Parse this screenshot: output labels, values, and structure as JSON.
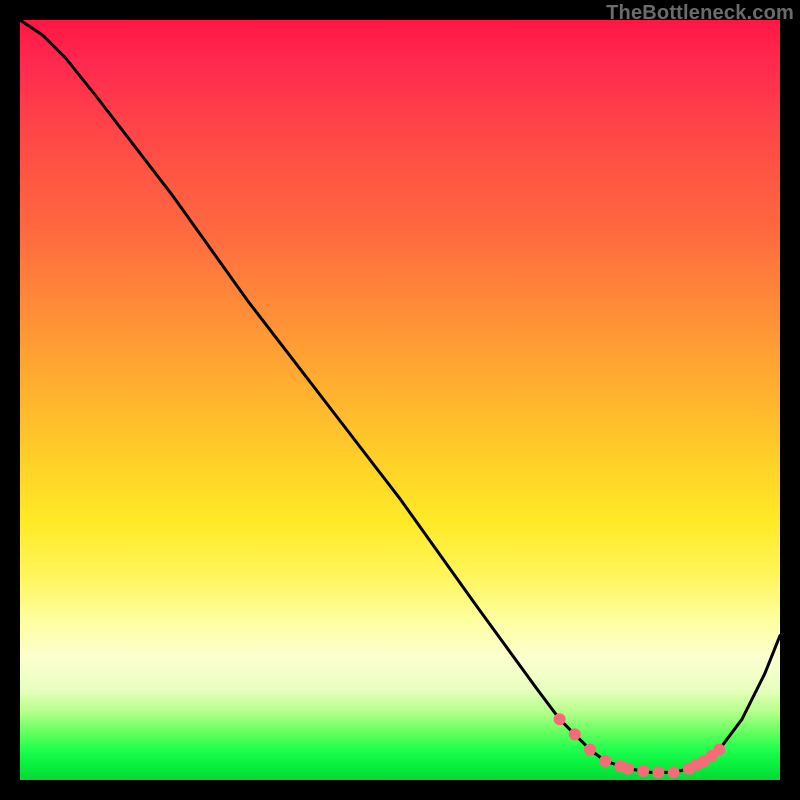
{
  "watermark": "TheBottleneck.com",
  "colors": {
    "background": "#000000",
    "curve": "#000000",
    "marker": "#f86a77",
    "gradient_top": "#ff1744",
    "gradient_bottom": "#06d836"
  },
  "chart_data": {
    "type": "line",
    "title": "",
    "xlabel": "",
    "ylabel": "",
    "xlim": [
      0,
      100
    ],
    "ylim": [
      0,
      100
    ],
    "grid": false,
    "legend": false,
    "series": [
      {
        "name": "bottleneck-curve",
        "x": [
          0,
          3,
          6,
          10,
          20,
          30,
          40,
          50,
          60,
          68,
          71,
          73,
          75,
          77,
          80,
          83,
          86,
          88,
          90,
          92,
          95,
          98,
          100
        ],
        "values": [
          100,
          98,
          95,
          90,
          77,
          63,
          50,
          37,
          23,
          12,
          8,
          6,
          4,
          2.5,
          1.5,
          1,
          1,
          1.5,
          2.5,
          4,
          8,
          14,
          19
        ]
      }
    ],
    "markers": {
      "comment": "pink dots clustered near the valley bottom",
      "x": [
        71,
        73,
        75,
        77,
        79,
        80,
        82,
        84,
        86,
        88,
        89,
        90,
        91,
        92
      ],
      "values": [
        8,
        6,
        4,
        2.5,
        1.8,
        1.5,
        1.2,
        1,
        1,
        1.5,
        2,
        2.5,
        3.2,
        4
      ]
    }
  }
}
